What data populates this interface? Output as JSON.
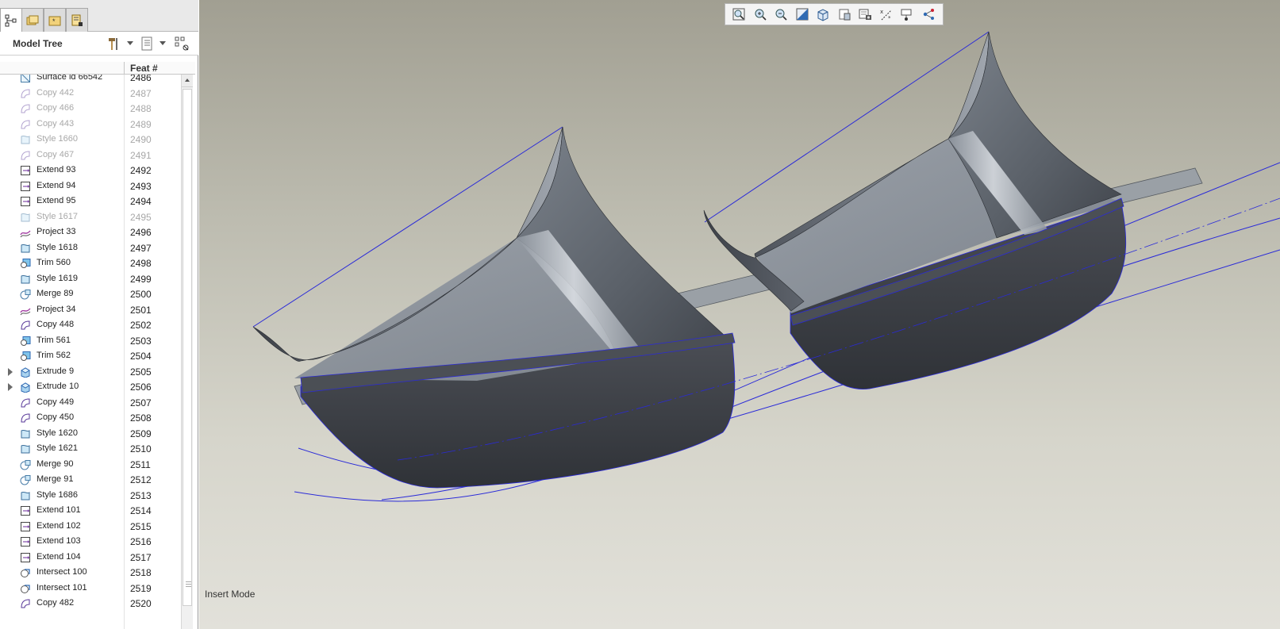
{
  "model_tree": {
    "title": "Model Tree",
    "column_feat_label": "Feat #",
    "tabs": [
      {
        "icon": "model-tree-icon",
        "active": true
      },
      {
        "icon": "folder-browser-icon",
        "active": false
      },
      {
        "icon": "favorites-icon",
        "active": false
      },
      {
        "icon": "layer-notes-icon",
        "active": false
      }
    ],
    "rows": [
      {
        "name": "Surface id 66542",
        "num": "2486",
        "icon": "surface",
        "dim": false,
        "expandable": false
      },
      {
        "name": "Copy 442",
        "num": "2487",
        "icon": "copy",
        "dim": true,
        "expandable": false
      },
      {
        "name": "Copy 466",
        "num": "2488",
        "icon": "copy",
        "dim": true,
        "expandable": false
      },
      {
        "name": "Copy 443",
        "num": "2489",
        "icon": "copy",
        "dim": true,
        "expandable": false
      },
      {
        "name": "Style 1660",
        "num": "2490",
        "icon": "style",
        "dim": true,
        "expandable": false
      },
      {
        "name": "Copy 467",
        "num": "2491",
        "icon": "copy",
        "dim": true,
        "expandable": false
      },
      {
        "name": "Extend 93",
        "num": "2492",
        "icon": "extend",
        "dim": false,
        "expandable": false
      },
      {
        "name": "Extend 94",
        "num": "2493",
        "icon": "extend",
        "dim": false,
        "expandable": false
      },
      {
        "name": "Extend 95",
        "num": "2494",
        "icon": "extend",
        "dim": false,
        "expandable": false
      },
      {
        "name": "Style 1617",
        "num": "2495",
        "icon": "style",
        "dim": true,
        "expandable": false
      },
      {
        "name": "Project 33",
        "num": "2496",
        "icon": "project",
        "dim": false,
        "expandable": false
      },
      {
        "name": "Style 1618",
        "num": "2497",
        "icon": "style",
        "dim": false,
        "expandable": false
      },
      {
        "name": "Trim 560",
        "num": "2498",
        "icon": "trim",
        "dim": false,
        "expandable": false
      },
      {
        "name": "Style 1619",
        "num": "2499",
        "icon": "style",
        "dim": false,
        "expandable": false
      },
      {
        "name": "Merge 89",
        "num": "2500",
        "icon": "merge",
        "dim": false,
        "expandable": false
      },
      {
        "name": "Project 34",
        "num": "2501",
        "icon": "project",
        "dim": false,
        "expandable": false
      },
      {
        "name": "Copy 448",
        "num": "2502",
        "icon": "copy",
        "dim": false,
        "expandable": false
      },
      {
        "name": "Trim 561",
        "num": "2503",
        "icon": "trim",
        "dim": false,
        "expandable": false
      },
      {
        "name": "Trim 562",
        "num": "2504",
        "icon": "trim",
        "dim": false,
        "expandable": false
      },
      {
        "name": "Extrude 9",
        "num": "2505",
        "icon": "extrude",
        "dim": false,
        "expandable": true
      },
      {
        "name": "Extrude 10",
        "num": "2506",
        "icon": "extrude",
        "dim": false,
        "expandable": true
      },
      {
        "name": "Copy 449",
        "num": "2507",
        "icon": "copy",
        "dim": false,
        "expandable": false
      },
      {
        "name": "Copy 450",
        "num": "2508",
        "icon": "copy",
        "dim": false,
        "expandable": false
      },
      {
        "name": "Style 1620",
        "num": "2509",
        "icon": "style",
        "dim": false,
        "expandable": false
      },
      {
        "name": "Style 1621",
        "num": "2510",
        "icon": "style",
        "dim": false,
        "expandable": false
      },
      {
        "name": "Merge 90",
        "num": "2511",
        "icon": "merge",
        "dim": false,
        "expandable": false
      },
      {
        "name": "Merge 91",
        "num": "2512",
        "icon": "merge",
        "dim": false,
        "expandable": false
      },
      {
        "name": "Style 1686",
        "num": "2513",
        "icon": "style",
        "dim": false,
        "expandable": false
      },
      {
        "name": "Extend 101",
        "num": "2514",
        "icon": "extend",
        "dim": false,
        "expandable": false
      },
      {
        "name": "Extend 102",
        "num": "2515",
        "icon": "extend",
        "dim": false,
        "expandable": false
      },
      {
        "name": "Extend 103",
        "num": "2516",
        "icon": "extend",
        "dim": false,
        "expandable": false
      },
      {
        "name": "Extend 104",
        "num": "2517",
        "icon": "extend",
        "dim": false,
        "expandable": false
      },
      {
        "name": "Intersect 100",
        "num": "2518",
        "icon": "intersect",
        "dim": false,
        "expandable": false
      },
      {
        "name": "Intersect 101",
        "num": "2519",
        "icon": "intersect",
        "dim": false,
        "expandable": false
      },
      {
        "name": "Copy 482",
        "num": "2520",
        "icon": "copy",
        "dim": false,
        "expandable": false
      }
    ]
  },
  "view_toolbar": {
    "buttons": [
      "refit-icon",
      "zoom-in-icon",
      "zoom-out-icon",
      "repaint-icon",
      "saved-views-icon",
      "display-style-icon",
      "view-manager-icon",
      "datum-display-icon",
      "annotation-display-icon",
      "spin-center-icon"
    ]
  },
  "graphics": {
    "mode_label": "Insert Mode",
    "colors": {
      "curve": "#2a2ad8",
      "surface_light": "#8e959e",
      "surface_dark": "#3c3f45",
      "background_top": "#a19f92",
      "background_bottom": "#e2e1da"
    }
  }
}
